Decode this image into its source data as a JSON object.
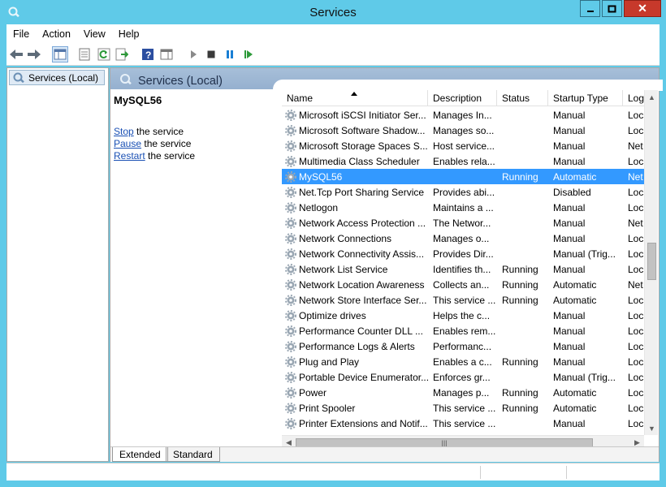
{
  "window": {
    "title": "Services"
  },
  "menu": [
    "File",
    "Action",
    "View",
    "Help"
  ],
  "toolbar_icons": [
    "back-arrow-icon",
    "forward-arrow-icon",
    "show-hide-console-tree-icon",
    "properties-icon",
    "refresh-icon",
    "export-list-icon",
    "help-icon",
    "show-hide-action-pane-icon",
    "start-service-icon",
    "stop-service-icon",
    "pause-service-icon",
    "resume-service-icon"
  ],
  "tree": {
    "item": "Services (Local)"
  },
  "panel": {
    "title": "Services (Local)"
  },
  "details": {
    "service_name": "MySQL56",
    "stop_link": "Stop",
    "stop_rest": " the service",
    "pause_link": "Pause",
    "pause_rest": " the service",
    "restart_link": "Restart",
    "restart_rest": " the service"
  },
  "columns": [
    "Name",
    "Description",
    "Status",
    "Startup Type",
    "Log"
  ],
  "rows": [
    {
      "name": "Microsoft iSCSI Initiator Ser...",
      "desc": "Manages In...",
      "status": "",
      "startup": "Manual",
      "log": "Loc"
    },
    {
      "name": "Microsoft Software Shadow...",
      "desc": "Manages so...",
      "status": "",
      "startup": "Manual",
      "log": "Loc"
    },
    {
      "name": "Microsoft Storage Spaces S...",
      "desc": "Host service...",
      "status": "",
      "startup": "Manual",
      "log": "Net"
    },
    {
      "name": "Multimedia Class Scheduler",
      "desc": "Enables rela...",
      "status": "",
      "startup": "Manual",
      "log": "Loc"
    },
    {
      "name": "MySQL56",
      "desc": "",
      "status": "Running",
      "startup": "Automatic",
      "log": "Net"
    },
    {
      "name": "Net.Tcp Port Sharing Service",
      "desc": "Provides abi...",
      "status": "",
      "startup": "Disabled",
      "log": "Loc"
    },
    {
      "name": "Netlogon",
      "desc": "Maintains a ...",
      "status": "",
      "startup": "Manual",
      "log": "Loc"
    },
    {
      "name": "Network Access Protection ...",
      "desc": "The Networ...",
      "status": "",
      "startup": "Manual",
      "log": "Net"
    },
    {
      "name": "Network Connections",
      "desc": "Manages o...",
      "status": "",
      "startup": "Manual",
      "log": "Loc"
    },
    {
      "name": "Network Connectivity Assis...",
      "desc": "Provides Dir...",
      "status": "",
      "startup": "Manual (Trig...",
      "log": "Loc"
    },
    {
      "name": "Network List Service",
      "desc": "Identifies th...",
      "status": "Running",
      "startup": "Manual",
      "log": "Loc"
    },
    {
      "name": "Network Location Awareness",
      "desc": "Collects an...",
      "status": "Running",
      "startup": "Automatic",
      "log": "Net"
    },
    {
      "name": "Network Store Interface Ser...",
      "desc": "This service ...",
      "status": "Running",
      "startup": "Automatic",
      "log": "Loc"
    },
    {
      "name": "Optimize drives",
      "desc": "Helps the c...",
      "status": "",
      "startup": "Manual",
      "log": "Loc"
    },
    {
      "name": "Performance Counter DLL ...",
      "desc": "Enables rem...",
      "status": "",
      "startup": "Manual",
      "log": "Loc"
    },
    {
      "name": "Performance Logs & Alerts",
      "desc": "Performanc...",
      "status": "",
      "startup": "Manual",
      "log": "Loc"
    },
    {
      "name": "Plug and Play",
      "desc": "Enables a c...",
      "status": "Running",
      "startup": "Manual",
      "log": "Loc"
    },
    {
      "name": "Portable Device Enumerator...",
      "desc": "Enforces gr...",
      "status": "",
      "startup": "Manual (Trig...",
      "log": "Loc"
    },
    {
      "name": "Power",
      "desc": "Manages p...",
      "status": "Running",
      "startup": "Automatic",
      "log": "Loc"
    },
    {
      "name": "Print Spooler",
      "desc": "This service ...",
      "status": "Running",
      "startup": "Automatic",
      "log": "Loc"
    },
    {
      "name": "Printer Extensions and Notif...",
      "desc": "This service ...",
      "status": "",
      "startup": "Manual",
      "log": "Loc"
    }
  ],
  "selected_row": 4,
  "tabs": [
    "Extended",
    "Standard"
  ],
  "colors": {
    "title_bar": "#5fcae8",
    "selection": "#3399ff",
    "close_button": "#c7392b",
    "link": "#1a50b4"
  }
}
